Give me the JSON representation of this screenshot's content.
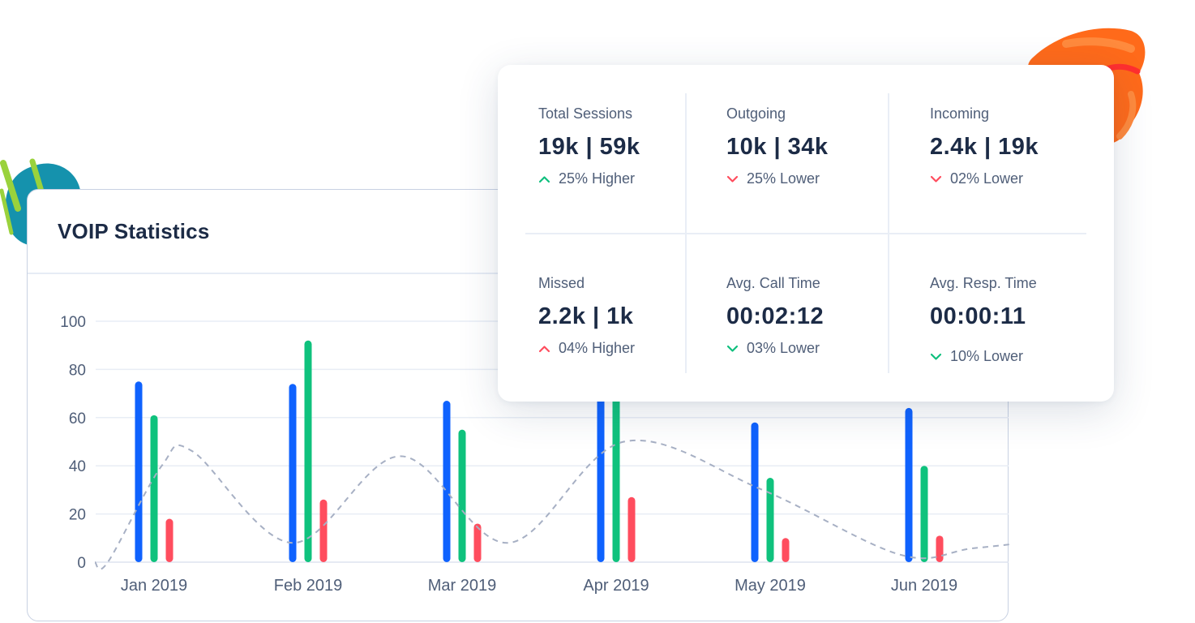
{
  "colors": {
    "incoming": "#0f62fe",
    "outgoing": "#0fc27d",
    "missed": "#ff4d5e",
    "trend": "#a7b0c4",
    "up_good": "#0fbf7d",
    "down_bad": "#ff4d5e",
    "up_bad": "#ff4d5e",
    "down_good": "#0fbf7d"
  },
  "chart_title": "VOIP Statistics",
  "chart_data": {
    "type": "bar",
    "categories": [
      "Jan 2019",
      "Feb 2019",
      "Mar 2019",
      "Apr 2019",
      "May 2019",
      "Jun 2019"
    ],
    "series": [
      {
        "values": [
          75,
          74,
          67,
          80,
          58,
          64
        ]
      },
      {
        "values": [
          61,
          92,
          55,
          85,
          35,
          40
        ]
      },
      {
        "values": [
          18,
          26,
          16,
          27,
          10,
          11
        ]
      }
    ],
    "trend_line": [
      {
        "x": 0.0,
        "y": 0
      },
      {
        "x": 0.35,
        "y": 40
      },
      {
        "x": 0.55,
        "y": 46
      },
      {
        "x": 1.2,
        "y": 8
      },
      {
        "x": 1.9,
        "y": 44
      },
      {
        "x": 2.6,
        "y": 8
      },
      {
        "x": 3.35,
        "y": 50
      },
      {
        "x": 4.25,
        "y": 30
      },
      {
        "x": 5.15,
        "y": 3
      },
      {
        "x": 5.65,
        "y": 6
      },
      {
        "x": 6.45,
        "y": 10
      },
      {
        "x": 6.8,
        "y": 0
      }
    ],
    "yticks": [
      0,
      20,
      40,
      60,
      80,
      100
    ],
    "ylim": [
      0,
      100
    ],
    "grid": true
  },
  "stats": [
    {
      "label": "Total Sessions",
      "value": "19k  |  59k",
      "change": "25% Higher",
      "trend": "up_good"
    },
    {
      "label": "Outgoing",
      "value": "10k  |  34k",
      "change": "25% Lower",
      "trend": "down_bad"
    },
    {
      "label": "Incoming",
      "value": "2.4k  |  19k",
      "change": "02% Lower",
      "trend": "down_bad"
    },
    {
      "label": "Missed",
      "value": "2.2k  |  1k",
      "change": "04% Higher",
      "trend": "up_bad"
    },
    {
      "label": "Avg. Call Time",
      "value": "00:02:12",
      "change": "03% Lower",
      "trend": "down_good"
    },
    {
      "label": "Avg. Resp. Time",
      "value": "00:00:11",
      "change": "10% Lower",
      "trend": "down_good"
    }
  ]
}
